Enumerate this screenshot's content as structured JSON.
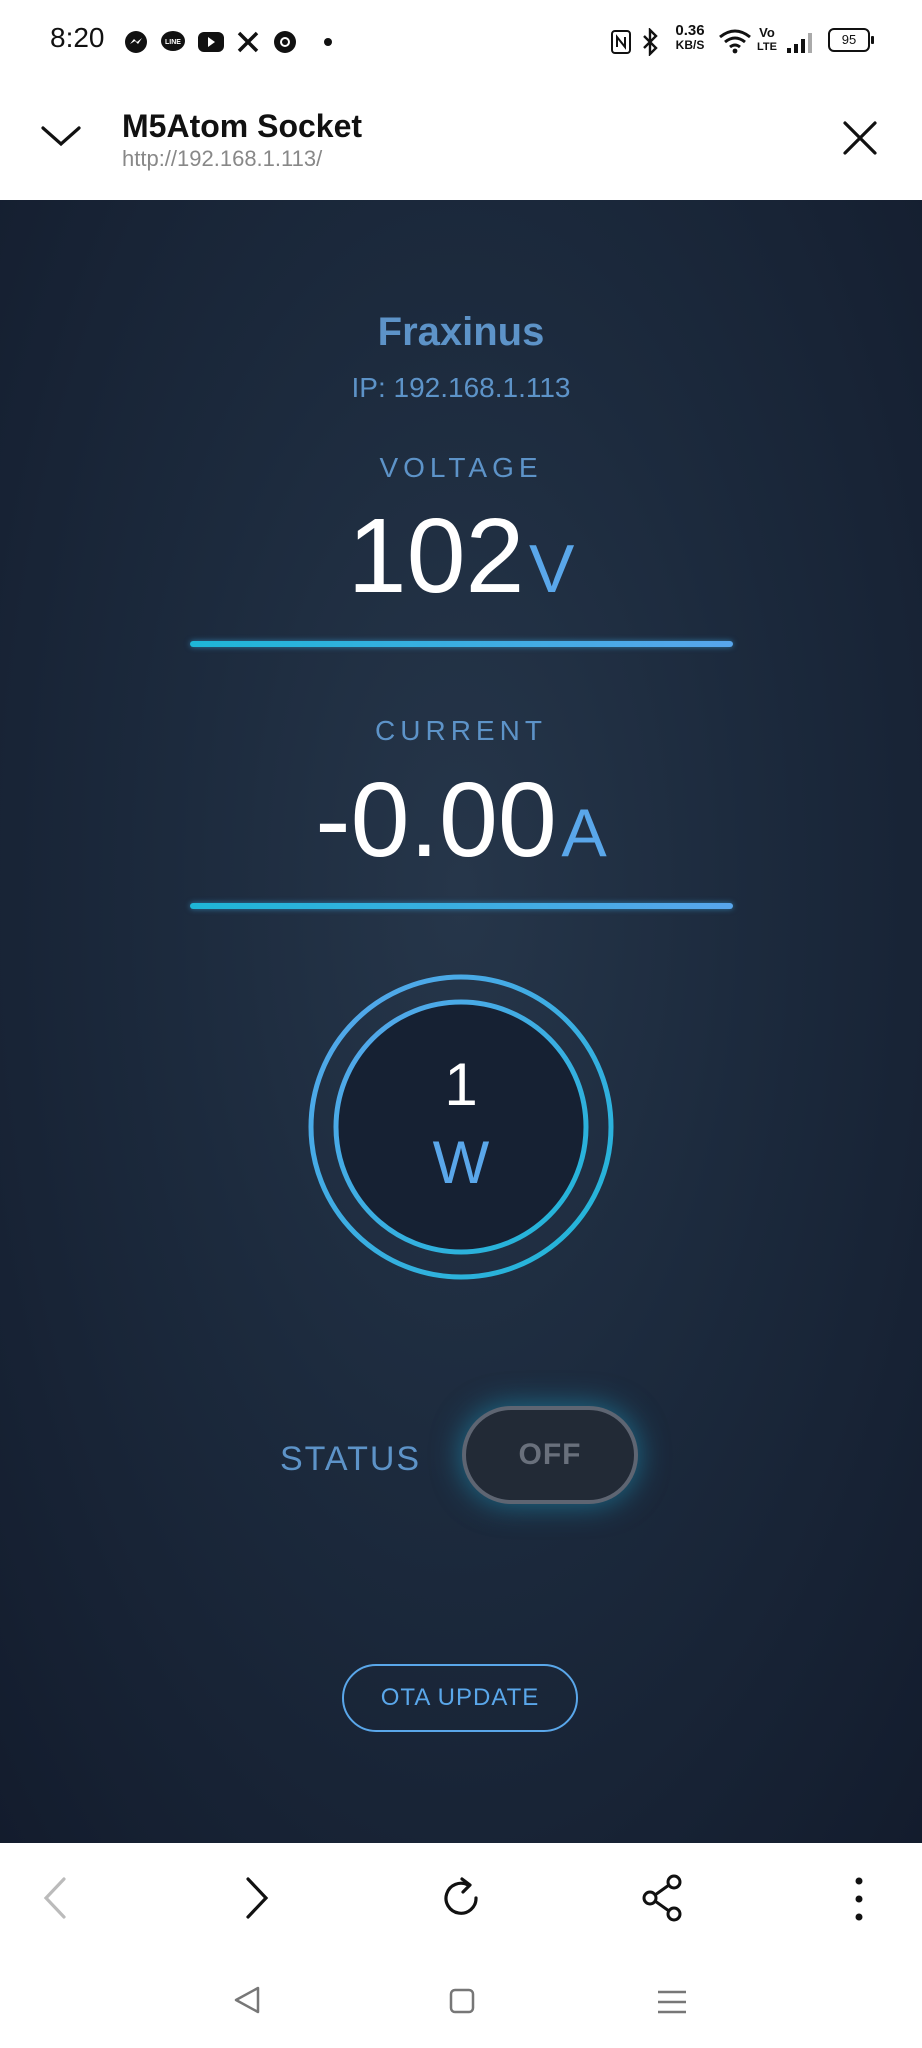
{
  "status_bar": {
    "time": "8:20",
    "network_speed_value": "0.36",
    "network_speed_unit": "KB/S",
    "volte_line1": "Vo",
    "volte_line2": "LTE",
    "battery": "95",
    "icons": [
      "messenger-icon",
      "line-icon",
      "youtube-icon",
      "x-icon",
      "chrome-icon",
      "dot-icon",
      "nfc-icon",
      "bluetooth-icon",
      "wifi-icon",
      "signal-icon",
      "battery-icon"
    ]
  },
  "browser": {
    "title": "M5Atom Socket",
    "url": "http://192.168.1.113/"
  },
  "device": {
    "name": "Fraxinus",
    "ip": "IP: 192.168.1.113"
  },
  "voltage": {
    "label": "VOLTAGE",
    "value": "102",
    "unit": "V"
  },
  "current": {
    "label": "CURRENT",
    "value": "-0.00",
    "unit": "A"
  },
  "power": {
    "value": "1",
    "unit": "W"
  },
  "status": {
    "label": "STATUS",
    "toggle_text": "OFF"
  },
  "ota_button": "OTA UPDATE",
  "colors": {
    "accent": "#5aa7ea",
    "cyan": "#1eb6d7",
    "background": "#1c2a3d"
  }
}
